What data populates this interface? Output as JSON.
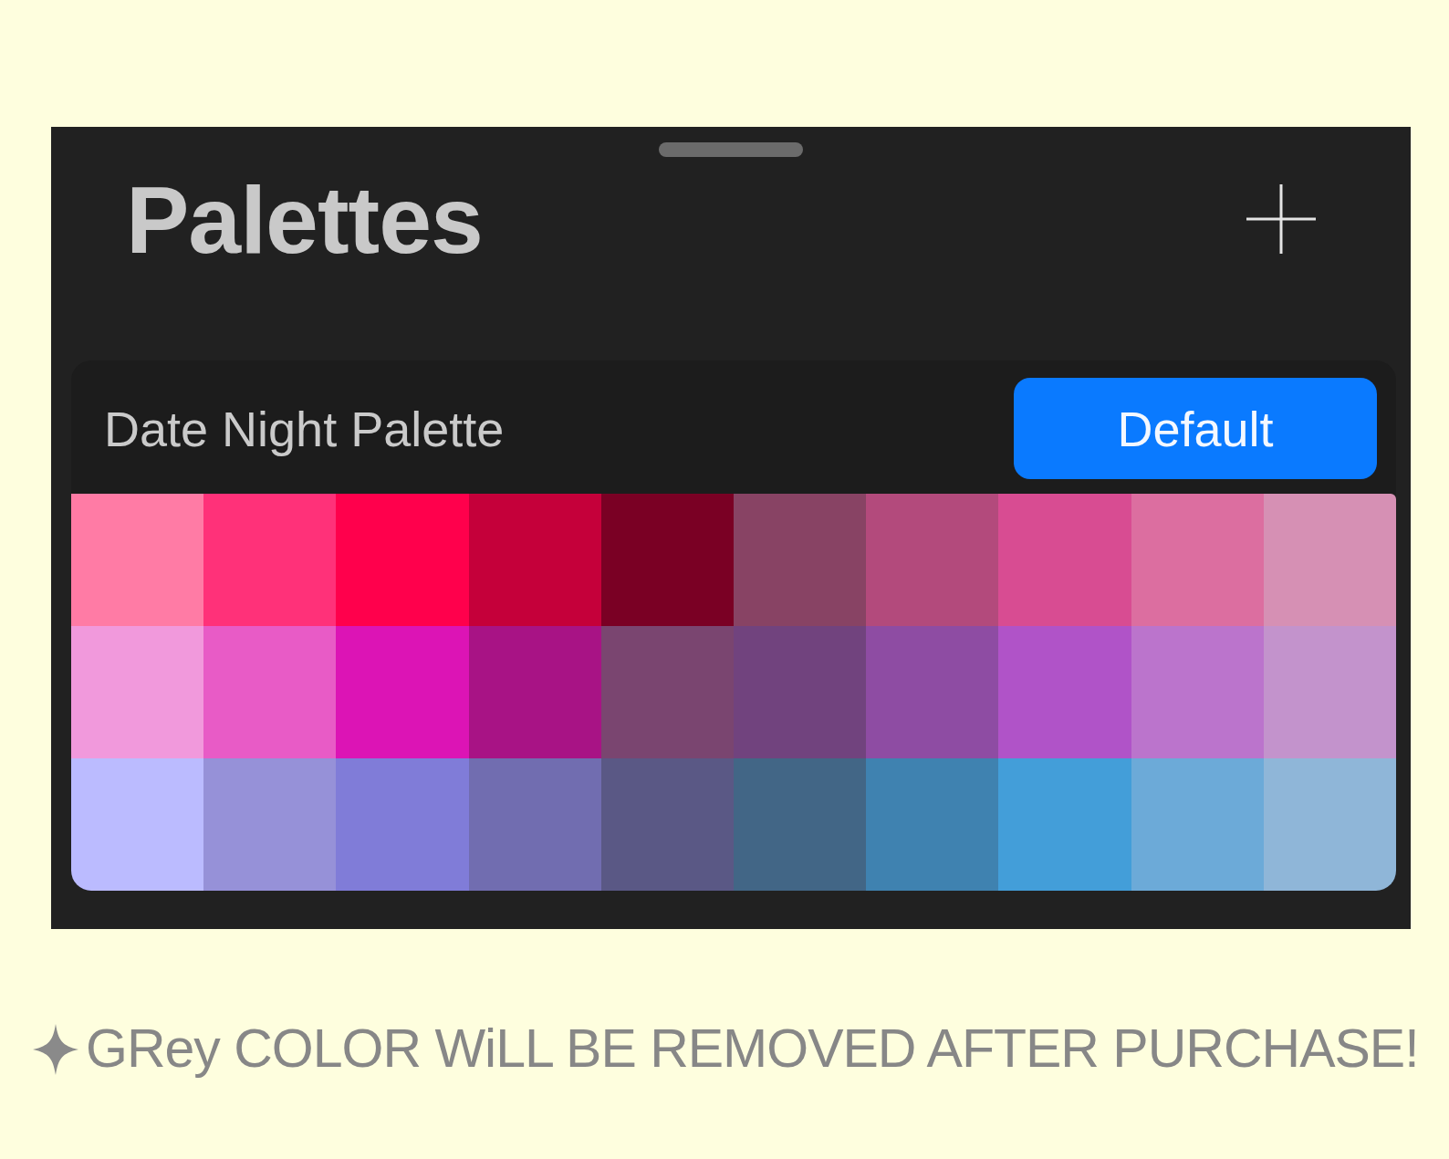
{
  "sheet": {
    "title": "Palettes"
  },
  "palette": {
    "name": "Date Night Palette",
    "default_button": "Default",
    "swatch_rows": [
      {
        "swatches": [
          {
            "color": "#ff7ba5"
          },
          {
            "color": "#ff3179"
          },
          {
            "color": "#ff004c"
          },
          {
            "color": "#c5003a"
          },
          {
            "color": "#7a0024"
          },
          {
            "color": "#884364"
          },
          {
            "color": "#b34a7c"
          },
          {
            "color": "#d84c92"
          },
          {
            "color": "#dc6ea0"
          },
          {
            "color": "#d690b4"
          }
        ]
      },
      {
        "swatches": [
          {
            "color": "#f199dc"
          },
          {
            "color": "#e85bc6"
          },
          {
            "color": "#dc14b5"
          },
          {
            "color": "#a81385"
          },
          {
            "color": "#7a4570"
          },
          {
            "color": "#71437e"
          },
          {
            "color": "#8e4ca3"
          },
          {
            "color": "#b053c8"
          },
          {
            "color": "#bb74cc"
          },
          {
            "color": "#c393cc"
          }
        ]
      },
      {
        "swatches": [
          {
            "color": "#bbbbff"
          },
          {
            "color": "#9691d8"
          },
          {
            "color": "#807cd8"
          },
          {
            "color": "#716db0"
          },
          {
            "color": "#5a5885"
          },
          {
            "color": "#426686"
          },
          {
            "color": "#3f82b0"
          },
          {
            "color": "#439ed9"
          },
          {
            "color": "#6caad8"
          },
          {
            "color": "#8fb6d8"
          }
        ]
      }
    ]
  },
  "caption": {
    "text": "GRey COLOR WiLL BE REMOVED AFTER PURCHASE!"
  }
}
